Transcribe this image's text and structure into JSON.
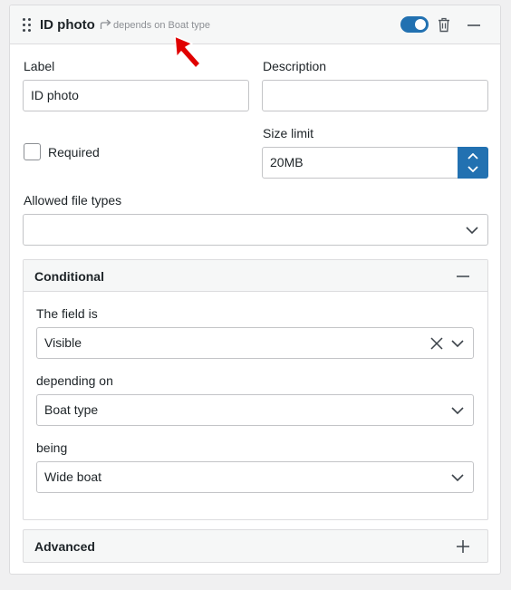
{
  "header": {
    "title": "ID photo",
    "dependency_text": "depends on Boat type",
    "enabled": true
  },
  "fields": {
    "label": {
      "label": "Label",
      "value": "ID photo"
    },
    "description": {
      "label": "Description",
      "value": ""
    },
    "required": {
      "label": "Required",
      "checked": false
    },
    "size_limit": {
      "label": "Size limit",
      "value": "20MB"
    },
    "allowed_types": {
      "label": "Allowed file types",
      "value": ""
    }
  },
  "conditional": {
    "title": "Conditional",
    "field_is_label": "The field is",
    "field_is_value": "Visible",
    "depending_on_label": "depending on",
    "depending_on_value": "Boat type",
    "being_label": "being",
    "being_value": "Wide boat"
  },
  "advanced": {
    "title": "Advanced"
  },
  "colors": {
    "accent": "#2271b1",
    "cursor": "#e00000",
    "border": "#c3c4c7"
  }
}
